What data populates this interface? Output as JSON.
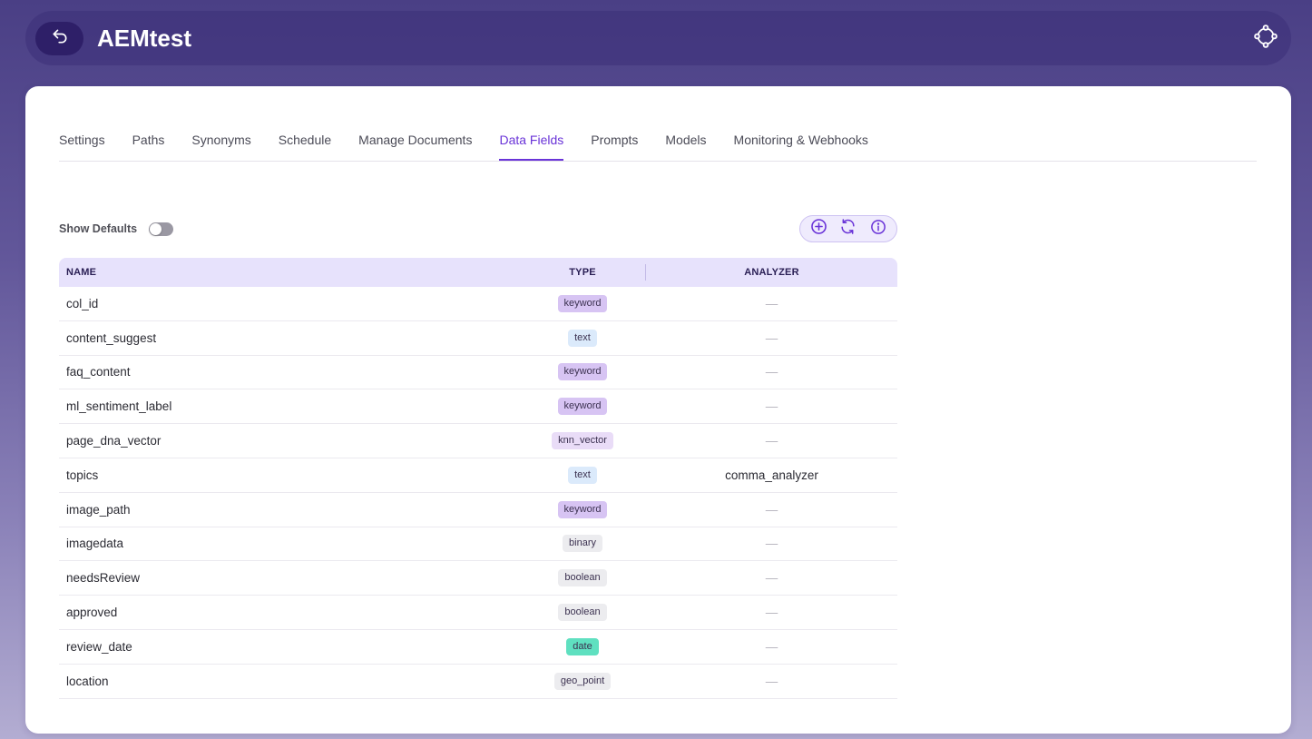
{
  "header": {
    "title": "AEMtest",
    "back_icon": "undo-arrow-icon",
    "focus_icon": "focus-target-icon"
  },
  "tabs": [
    {
      "label": "Settings",
      "active": false
    },
    {
      "label": "Paths",
      "active": false
    },
    {
      "label": "Synonyms",
      "active": false
    },
    {
      "label": "Schedule",
      "active": false
    },
    {
      "label": "Manage Documents",
      "active": false
    },
    {
      "label": "Data Fields",
      "active": true
    },
    {
      "label": "Prompts",
      "active": false
    },
    {
      "label": "Models",
      "active": false
    },
    {
      "label": "Monitoring & Webhooks",
      "active": false
    }
  ],
  "controls": {
    "show_defaults_label": "Show Defaults",
    "show_defaults_on": false,
    "actions": [
      "add-circle-icon",
      "refresh-icon",
      "info-icon"
    ]
  },
  "table": {
    "columns": [
      "NAME",
      "TYPE",
      "ANALYZER"
    ],
    "rows": [
      {
        "name": "col_id",
        "type": "keyword",
        "analyzer": "—"
      },
      {
        "name": "content_suggest",
        "type": "text",
        "analyzer": "—"
      },
      {
        "name": "faq_content",
        "type": "keyword",
        "analyzer": "—"
      },
      {
        "name": "ml_sentiment_label",
        "type": "keyword",
        "analyzer": "—"
      },
      {
        "name": "page_dna_vector",
        "type": "knn_vector",
        "analyzer": "—"
      },
      {
        "name": "topics",
        "type": "text",
        "analyzer": "comma_analyzer"
      },
      {
        "name": "image_path",
        "type": "keyword",
        "analyzer": "—"
      },
      {
        "name": "imagedata",
        "type": "binary",
        "analyzer": "—"
      },
      {
        "name": "needsReview",
        "type": "boolean",
        "analyzer": "—"
      },
      {
        "name": "approved",
        "type": "boolean",
        "analyzer": "—"
      },
      {
        "name": "review_date",
        "type": "date",
        "analyzer": "—"
      },
      {
        "name": "location",
        "type": "geo_point",
        "analyzer": "—"
      }
    ]
  },
  "type_colors": {
    "keyword": "#d7c4f3",
    "text": "#dbeafb",
    "knn_vector": "#e9dcf7",
    "binary": "#ececef",
    "boolean": "#ececef",
    "date": "#5fe0c0",
    "geo_point": "#ececef"
  },
  "accent_color": "#6a34d8"
}
